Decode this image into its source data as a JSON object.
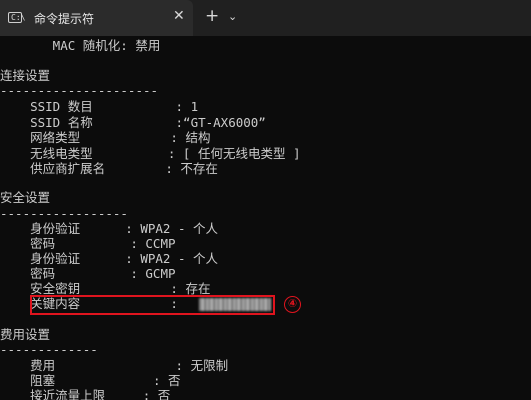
{
  "window": {
    "tab_title": "命令提示符",
    "tab_icon_text": "C:\\",
    "tab_close_glyph": "✕",
    "new_tab_glyph": "+",
    "dropdown_glyph": "⌄"
  },
  "terminal": {
    "mac_line": "       MAC 随机化: 禁用",
    "connectivity": {
      "header": "连接设置",
      "divider": "---------------------",
      "rows": [
        {
          "label": "    SSID 数目           ",
          "value": ": 1"
        },
        {
          "label": "    SSID 名称           ",
          "value": ":“GT-AX6000”"
        },
        {
          "label": "    网络类型            ",
          "value": ": 结构"
        },
        {
          "label": "    无线电类型          ",
          "value": ": [ 任何无线电类型 ]"
        },
        {
          "label": "    供应商扩展名        ",
          "value": ": 不存在"
        }
      ]
    },
    "security": {
      "header": "安全设置",
      "divider": "-----------------",
      "rows": [
        {
          "label": "    身份验证      ",
          "value": ": WPA2 - 个人"
        },
        {
          "label": "    密码          ",
          "value": ": CCMP"
        },
        {
          "label": "    身份验证      ",
          "value": ": WPA2 - 个人"
        },
        {
          "label": "    密码          ",
          "value": ": GCMP"
        },
        {
          "label": "    安全密钥            ",
          "value": ": 存在"
        },
        {
          "label": "    关键内容            ",
          "value": ": "
        }
      ],
      "step_marker": "④"
    },
    "cost": {
      "header": "费用设置",
      "divider": "-------------",
      "rows": [
        {
          "label": "    费用                ",
          "value": ": 无限制"
        },
        {
          "label": "    阻塞             ",
          "value": ": 否"
        },
        {
          "label": "    接近流量上限     ",
          "value": ": 否"
        }
      ]
    }
  },
  "colors": {
    "background": "#0c0c0c",
    "text": "#cccccc",
    "tab_active": "#2b2b2b",
    "tab_bar": "#202020",
    "highlight": "#e0141e"
  }
}
